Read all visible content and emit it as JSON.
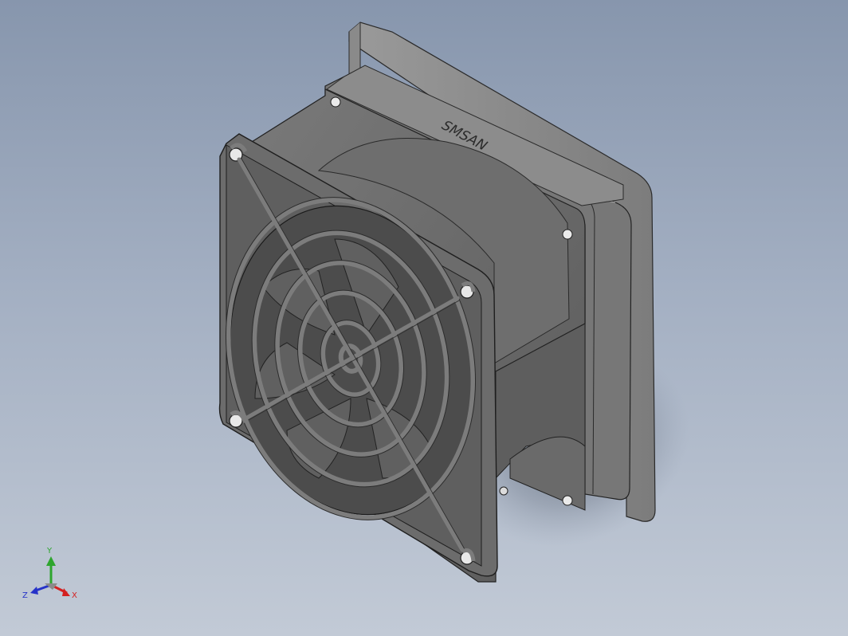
{
  "model": {
    "brand_label": "SMSAN"
  },
  "triad": {
    "y_label": "Y",
    "x_label": "X",
    "z_label": "Z",
    "colors": {
      "x": "#d42020",
      "y": "#2ea52e",
      "z": "#2632c8"
    }
  }
}
